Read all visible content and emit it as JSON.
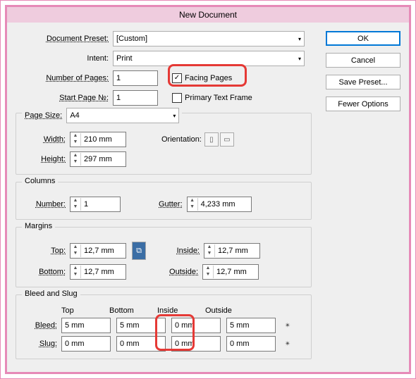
{
  "title": "New Document",
  "buttons": {
    "ok": "OK",
    "cancel": "Cancel",
    "save_preset": "Save Preset...",
    "fewer_options": "Fewer Options"
  },
  "preset": {
    "label": "Document Preset:",
    "value": "[Custom]"
  },
  "intent": {
    "label": "Intent:",
    "value": "Print"
  },
  "pages": {
    "label": "Number of Pages:",
    "value": "1"
  },
  "start": {
    "label": "Start Page №:",
    "value": "1"
  },
  "facing": {
    "label": "Facing Pages",
    "checked": true
  },
  "ptf": {
    "label": "Primary Text Frame",
    "checked": false
  },
  "pagesize": {
    "label": "Page Size:",
    "value": "A4"
  },
  "width": {
    "label": "Width:",
    "value": "210 mm"
  },
  "height": {
    "label": "Height:",
    "value": "297 mm"
  },
  "orientation_label": "Orientation:",
  "columns": {
    "legend": "Columns",
    "number_label": "Number:",
    "number": "1",
    "gutter_label": "Gutter:",
    "gutter": "4,233 mm"
  },
  "margins": {
    "legend": "Margins",
    "top_label": "Top:",
    "top": "12,7 mm",
    "bottom_label": "Bottom:",
    "bottom": "12,7 mm",
    "inside_label": "Inside:",
    "inside": "12,7 mm",
    "outside_label": "Outside:",
    "outside": "12,7 mm"
  },
  "bs": {
    "legend": "Bleed and Slug",
    "head": {
      "top": "Top",
      "bottom": "Bottom",
      "inside": "Inside",
      "outside": "Outside"
    },
    "bleed_label": "Bleed:",
    "slug_label": "Slug:",
    "bleed": {
      "top": "5 mm",
      "bottom": "5 mm",
      "inside": "0 mm",
      "outside": "5 mm"
    },
    "slug": {
      "top": "0 mm",
      "bottom": "0 mm",
      "inside": "0 mm",
      "outside": "0 mm"
    }
  }
}
